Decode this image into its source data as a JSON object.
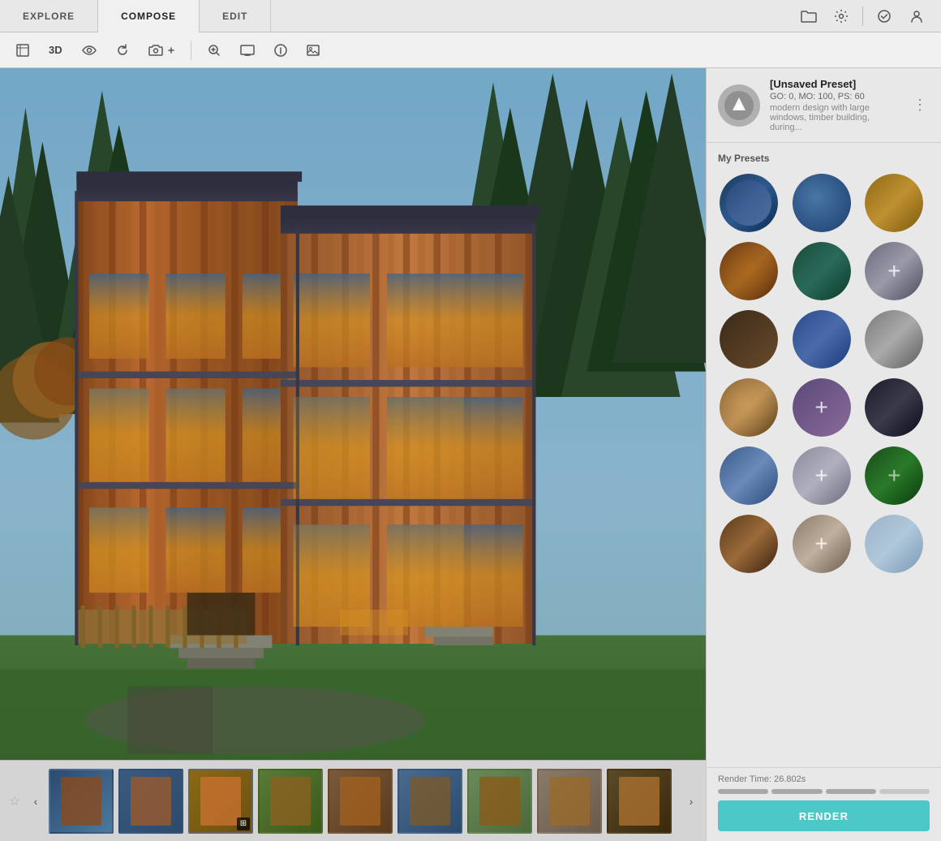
{
  "nav": {
    "tabs": [
      {
        "id": "explore",
        "label": "EXPLORE",
        "active": false
      },
      {
        "id": "compose",
        "label": "COMPOSE",
        "active": true
      },
      {
        "id": "edit",
        "label": "EDIT",
        "active": false
      }
    ],
    "icons": {
      "folder": "🗂",
      "settings": "⚙",
      "check": "✓",
      "user": "👤"
    }
  },
  "toolbar": {
    "view3d_label": "3D",
    "icons": {
      "frame": "⬜",
      "eye": "👁",
      "refresh": "↺",
      "camera": "📷",
      "zoom": "⊕",
      "monitor": "🖥",
      "info": "ℹ",
      "image": "🖼"
    }
  },
  "preset_card": {
    "title": "[Unsaved Preset]",
    "meta": "GO: 0, MO: 100, PS: 60",
    "desc": "modern design with large windows, timber building, during...",
    "avatar_icon": "✓"
  },
  "presets_section": {
    "label": "My Presets",
    "items": [
      {
        "id": 1,
        "has_plus": false,
        "color_class": "tb1"
      },
      {
        "id": 2,
        "has_plus": false,
        "color_class": "tb2"
      },
      {
        "id": 3,
        "has_plus": false,
        "color_class": "tb3"
      },
      {
        "id": 4,
        "has_plus": false,
        "color_class": "tb4"
      },
      {
        "id": 5,
        "has_plus": false,
        "color_class": "tb5"
      },
      {
        "id": 6,
        "has_plus": true,
        "color_class": "tb6"
      },
      {
        "id": 7,
        "has_plus": false,
        "color_class": "tb7"
      },
      {
        "id": 8,
        "has_plus": false,
        "color_class": "tb8"
      },
      {
        "id": 9,
        "has_plus": false,
        "color_class": "tb9"
      },
      {
        "id": 10,
        "has_plus": false,
        "color_class": "tb10"
      },
      {
        "id": 11,
        "has_plus": false,
        "color_class": "tb11"
      },
      {
        "id": 12,
        "has_plus": false,
        "color_class": "tb12"
      },
      {
        "id": 13,
        "has_plus": false,
        "color_class": "tb13"
      },
      {
        "id": 14,
        "has_plus": false,
        "color_class": "tb14"
      },
      {
        "id": 15,
        "has_plus": true,
        "color_class": "tb15"
      },
      {
        "id": 16,
        "has_plus": false,
        "color_class": "tb16"
      },
      {
        "id": 17,
        "has_plus": true,
        "color_class": "tb17"
      },
      {
        "id": 18,
        "has_plus": true,
        "color_class": "tb18"
      }
    ]
  },
  "render": {
    "time_label": "Render Time: 26.802s",
    "button_label": "RENDER"
  },
  "thumbnails": [
    {
      "id": 1,
      "active": false,
      "color_class": "thumb-bg1"
    },
    {
      "id": 2,
      "active": false,
      "color_class": "thumb-bg2"
    },
    {
      "id": 3,
      "active": true,
      "color_class": "thumb-bg3"
    },
    {
      "id": 4,
      "active": false,
      "color_class": "thumb-bg4"
    },
    {
      "id": 5,
      "active": false,
      "color_class": "thumb-bg5"
    },
    {
      "id": 6,
      "active": false,
      "color_class": "thumb-bg6"
    },
    {
      "id": 7,
      "active": false,
      "color_class": "thumb-bg7"
    },
    {
      "id": 8,
      "active": false,
      "color_class": "thumb-bg8"
    },
    {
      "id": 9,
      "active": false,
      "color_class": "thumb-bg9"
    }
  ]
}
